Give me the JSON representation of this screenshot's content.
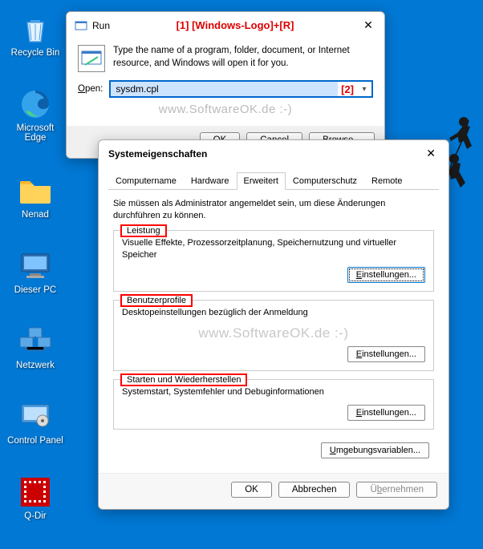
{
  "desktop": {
    "icons": [
      {
        "label": "Recycle Bin",
        "name": "recycle-bin"
      },
      {
        "label": "Microsoft Edge",
        "name": "edge"
      },
      {
        "label": "Nenad",
        "name": "folder-nenad"
      },
      {
        "label": "Dieser PC",
        "name": "this-pc"
      },
      {
        "label": "Netzwerk",
        "name": "network"
      },
      {
        "label": "Control Panel",
        "name": "control-panel"
      },
      {
        "label": "Q-Dir",
        "name": "qdir"
      }
    ]
  },
  "annotations": {
    "step1": "[1]  [Windows-Logo]+[R]",
    "step2": "[2]"
  },
  "run": {
    "title": "Run",
    "description": "Type the name of a program, folder, document, or Internet resource, and Windows will open it for you.",
    "open_label": "Open:",
    "input_value": "sysdm.cpl",
    "ok": "OK",
    "cancel": "Cancel",
    "browse": "Browse..."
  },
  "watermark": "www.SoftwareOK.de :-)",
  "sysprop": {
    "title": "Systemeigenschaften",
    "tabs": [
      "Computername",
      "Hardware",
      "Erweitert",
      "Computerschutz",
      "Remote"
    ],
    "active_tab": "Erweitert",
    "admin_note": "Sie müssen als Administrator angemeldet sein, um diese Änderungen durchführen zu können.",
    "groups": [
      {
        "title": "Leistung",
        "desc": "Visuelle Effekte, Prozessorzeitplanung, Speichernutzung und virtueller Speicher",
        "btn": "Einstellungen...",
        "focused": true
      },
      {
        "title": "Benutzerprofile",
        "desc": "Desktopeinstellungen bezüglich der Anmeldung",
        "btn": "Einstellungen..."
      },
      {
        "title": "Starten und Wiederherstellen",
        "desc": "Systemstart, Systemfehler und Debuginformationen",
        "btn": "Einstellungen..."
      }
    ],
    "env_btn": "Umgebungsvariablen...",
    "ok": "OK",
    "cancel": "Abbrechen",
    "apply": "Übernehmen"
  }
}
